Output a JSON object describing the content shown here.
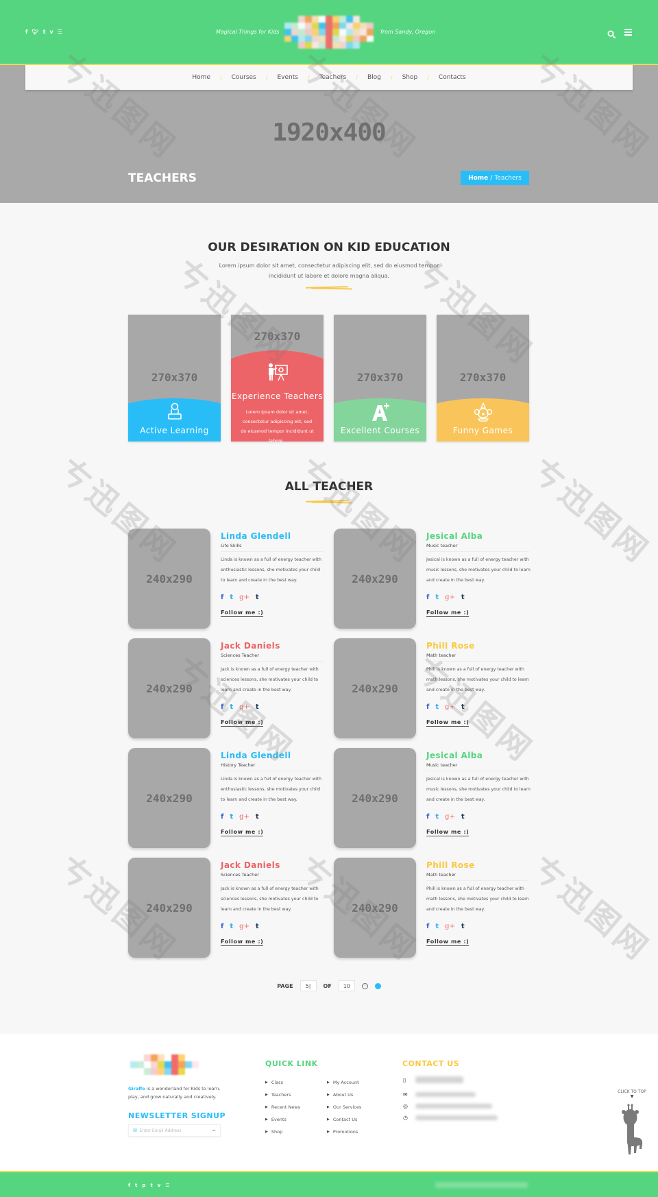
{
  "header": {
    "social": [
      "f",
      "t",
      "t",
      "v",
      "rss"
    ],
    "tagline_left": "Magical Things for Kids",
    "tagline_right": "from Sandy, Oregon",
    "search_icon": "search-icon",
    "menu_icon": "hamburger-menu-icon"
  },
  "nav": {
    "items": [
      "Home",
      "Courses",
      "Events",
      "Teachers",
      "Blog",
      "Shop",
      "Contacts"
    ],
    "separator": "/"
  },
  "hero": {
    "placeholder": "1920x400",
    "title": "TEACHERS",
    "breadcrumb_home": "Home",
    "breadcrumb_sep": "/",
    "breadcrumb_current": "Teachers",
    "breadcrumb_color": "#29bdf7"
  },
  "intro": {
    "title": "OUR DESIRATION ON KID EDUCATION",
    "subtitle": "Lorem ipsum dolor sit amet, consectetur adipiscing elit, sed do eiusmod tempor incididunt ut labore et dolore magna aliqua."
  },
  "features": [
    {
      "placeholder": "270x370",
      "label": "Active Learning",
      "icon": "student-laptop-icon",
      "color": "#29bdf7"
    },
    {
      "placeholder": "270x370",
      "label": "Experience Teachers",
      "icon": "teacher-board-icon",
      "color": "#ec6468",
      "description": "Lorem ipsum dolor sit amet, consectetur adipiscing elit, sed do eiusmod tempor incididunt ut labore ."
    },
    {
      "placeholder": "270x370",
      "label": "Excellent Courses",
      "icon": "a-plus-icon",
      "color": "#84d59c"
    },
    {
      "placeholder": "270x370",
      "label": "Funny Games",
      "icon": "clown-icon",
      "color": "#f9c55a"
    }
  ],
  "teachers_section": {
    "title": "ALL TEACHER"
  },
  "teachers": [
    {
      "photo": "240x290",
      "name": "Linda Glendell",
      "role": "Life Skills",
      "bio": "Linda is known as a full of energy teacher with enthusiastic lessons, she motivates your child to learn and create in the best way.",
      "color": "#29bdf7",
      "follow": "Follow me :)"
    },
    {
      "photo": "240x290",
      "name": "Jesical Alba",
      "role": "Music teacher",
      "bio": "Jesical is known as a full of energy teacher with music lessons, she motivates your child to learn and create in the best way.",
      "color": "#55d57f",
      "follow": "Follow me :)"
    },
    {
      "photo": "240x290",
      "name": "Jack Daniels",
      "role": "Sciences Teacher",
      "bio": "Jack is known as a full of energy teacher with sciences lessons, she motivates your child to learn and create in the best way.",
      "color": "#ec6468",
      "follow": "Follow me :)"
    },
    {
      "photo": "240x290",
      "name": "Phill Rose",
      "role": "Math teacher",
      "bio": "Phill is known as a full of energy teacher with math lessons, she motivates your child to learn and create in the best way.",
      "color": "#f9c940",
      "follow": "Follow me :)"
    },
    {
      "photo": "240x290",
      "name": "Linda Glendell",
      "role": "History Teacher",
      "bio": "Linda is known as a full of energy teacher with enthusiastic lessons, she motivates your child to learn and create in the best way.",
      "color": "#29bdf7",
      "follow": "Follow me :)"
    },
    {
      "photo": "240x290",
      "name": "Jesical Alba",
      "role": "Music teacher",
      "bio": "Jesical is known as a full of energy teacher with music lessons, she motivates your child to learn and create in the best way.",
      "color": "#55d57f",
      "follow": "Follow me :)"
    },
    {
      "photo": "240x290",
      "name": "Jack Daniels",
      "role": "Sciences Teacher",
      "bio": "Jack is known as a full of energy teacher with sciences lessons, she motivates your child to learn and create in the best way.",
      "color": "#ec6468",
      "follow": "Follow me :)"
    },
    {
      "photo": "240x290",
      "name": "Phill Rose",
      "role": "Math teacher",
      "bio": "Phill is known as a full of energy teacher with math lessons, she motivates your child to learn and create in the best way.",
      "color": "#f9c940",
      "follow": "Follow me :)"
    }
  ],
  "teacher_social": [
    {
      "glyph": "f",
      "icon": "facebook-icon",
      "color": "#3b63d6"
    },
    {
      "glyph": "t",
      "icon": "twitter-icon",
      "color": "#29aaf0"
    },
    {
      "glyph": "g+",
      "icon": "google-plus-icon",
      "color": "#ef6a6a"
    },
    {
      "glyph": "t",
      "icon": "tumblr-icon",
      "color": "#1f3a5a"
    }
  ],
  "pagination": {
    "page_label": "PAGE",
    "current": "5|",
    "of_label": "OF",
    "total": "10"
  },
  "footer": {
    "about_brand": "Giraffe",
    "about_text": " is a wonderland for Kids to learn, play, and grow naturally and creatively.",
    "newsletter_title": "NEWSLETTER SIGNUP",
    "newsletter_placeholder": "Enter Email Address",
    "quick_title": "QUICK LINK",
    "quick_col1": [
      "Class",
      "Teachers",
      "Recent News",
      "Events",
      "Shop"
    ],
    "quick_col2": [
      "My Account",
      "About Us",
      "Our Services",
      "Contact Us",
      "Promotions"
    ],
    "contact_title": "CONTACT US",
    "contact_icons": [
      "phone-icon",
      "mail-icon",
      "location-icon",
      "clock-icon"
    ],
    "to_top": "CLICK TO TOP",
    "colors": {
      "newsletter": "#29bdf7",
      "quick": "#55d57f",
      "contact": "#f9c940"
    }
  },
  "bottom": {
    "social": [
      "f",
      "t",
      "p",
      "t",
      "v",
      "rss"
    ]
  }
}
